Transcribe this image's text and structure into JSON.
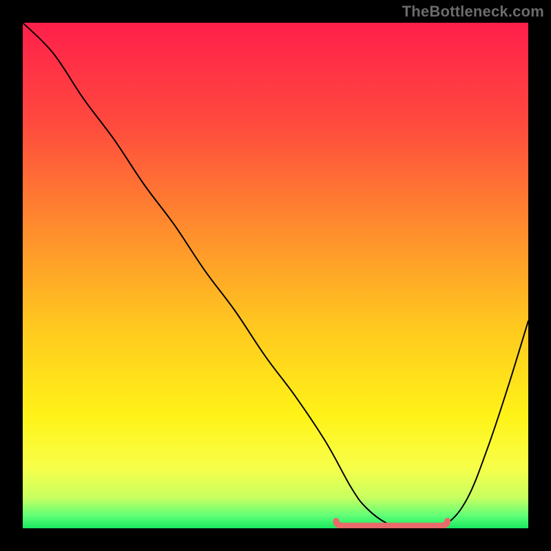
{
  "watermark": "TheBottleneck.com",
  "chart_data": {
    "type": "line",
    "title": "",
    "xlabel": "",
    "ylabel": "",
    "xlim": [
      0,
      100
    ],
    "ylim": [
      0,
      100
    ],
    "x": [
      0,
      6,
      12,
      18,
      24,
      30,
      36,
      42,
      48,
      54,
      60,
      65,
      68,
      72,
      76,
      80,
      84,
      88,
      92,
      96,
      100
    ],
    "values": [
      100,
      94,
      85,
      77,
      68,
      60,
      51,
      43,
      34,
      26,
      17,
      8,
      4,
      1,
      0,
      0,
      1,
      6,
      16,
      28,
      41
    ],
    "trough": {
      "x_start": 62,
      "x_end": 84,
      "y": 0.5
    },
    "gradient_stops": [
      {
        "offset": 0.0,
        "color": "#ff1f4b"
      },
      {
        "offset": 0.2,
        "color": "#ff4a3e"
      },
      {
        "offset": 0.4,
        "color": "#ff8a2e"
      },
      {
        "offset": 0.6,
        "color": "#ffc81f"
      },
      {
        "offset": 0.78,
        "color": "#fff318"
      },
      {
        "offset": 0.88,
        "color": "#f7ff4a"
      },
      {
        "offset": 0.94,
        "color": "#c7ff60"
      },
      {
        "offset": 0.975,
        "color": "#5fff77"
      },
      {
        "offset": 1.0,
        "color": "#18e860"
      }
    ],
    "colors": {
      "background": "#000000",
      "curve": "#000000",
      "trough_marker": "#e96a6a"
    }
  }
}
